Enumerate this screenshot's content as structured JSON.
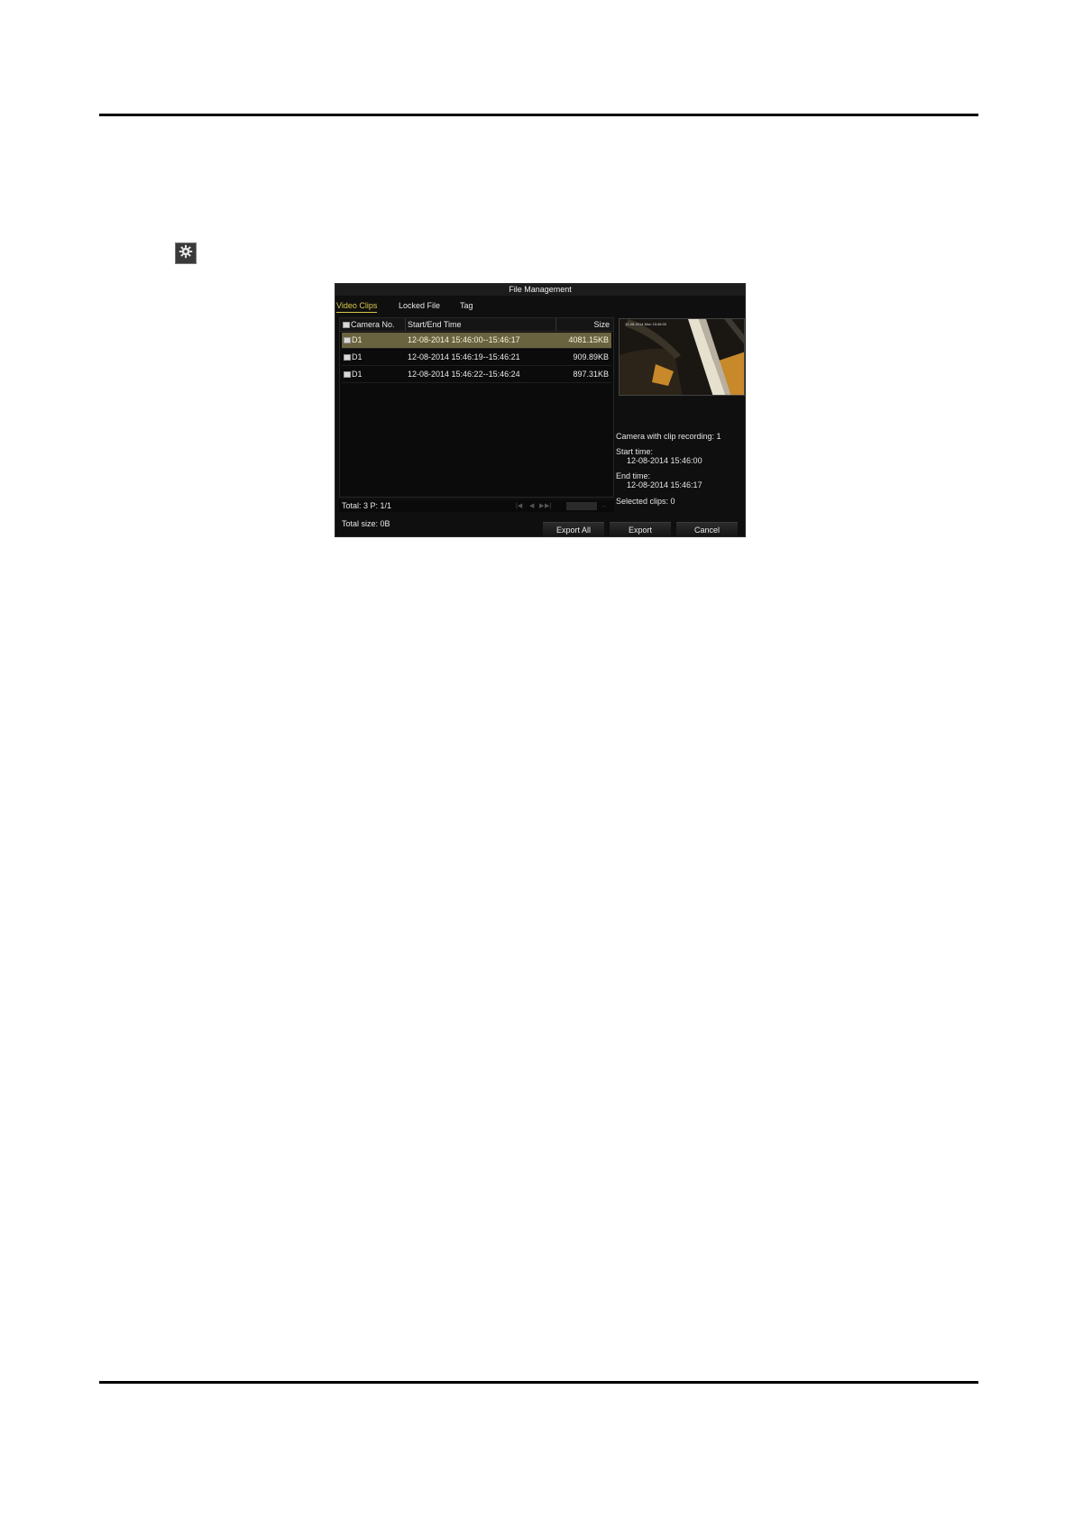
{
  "dialog": {
    "title": "File Management",
    "tabs": [
      {
        "label": "Video Clips",
        "active": true
      },
      {
        "label": "Locked File",
        "active": false
      },
      {
        "label": "Tag",
        "active": false
      }
    ],
    "columns": {
      "camera": "Camera No.",
      "time": "Start/End Time",
      "size": "Size"
    },
    "rows": [
      {
        "camera": "D1",
        "time": "12-08-2014 15:46:00--15:46:17",
        "size": "4081.15KB",
        "selected": true
      },
      {
        "camera": "D1",
        "time": "12-08-2014 15:46:19--15:46:21",
        "size": "909.89KB",
        "selected": false
      },
      {
        "camera": "D1",
        "time": "12-08-2014 15:46:22--15:46:24",
        "size": "897.31KB",
        "selected": false
      }
    ],
    "pager": {
      "total": "Total: 3  P: 1/1"
    },
    "total_size": "Total size: 0B",
    "buttons": {
      "export_all": "Export All",
      "export": "Export",
      "cancel": "Cancel"
    },
    "preview": {
      "timestamp": "12-08-2014 Mon 15:46:00"
    },
    "info": {
      "camera_with_clip": "Camera with clip recording: 1",
      "start_label": "Start time:",
      "start_value": "12-08-2014 15:46:00",
      "end_label": "End time:",
      "end_value": "12-08-2014 15:46:17",
      "selected_clips": "Selected clips: 0"
    }
  },
  "colors": {
    "accent": "#d9c94a",
    "selected_row": "#6a6340",
    "dialog_bg": "#0f0f0f"
  },
  "icons": {
    "settings": "gear-icon"
  }
}
